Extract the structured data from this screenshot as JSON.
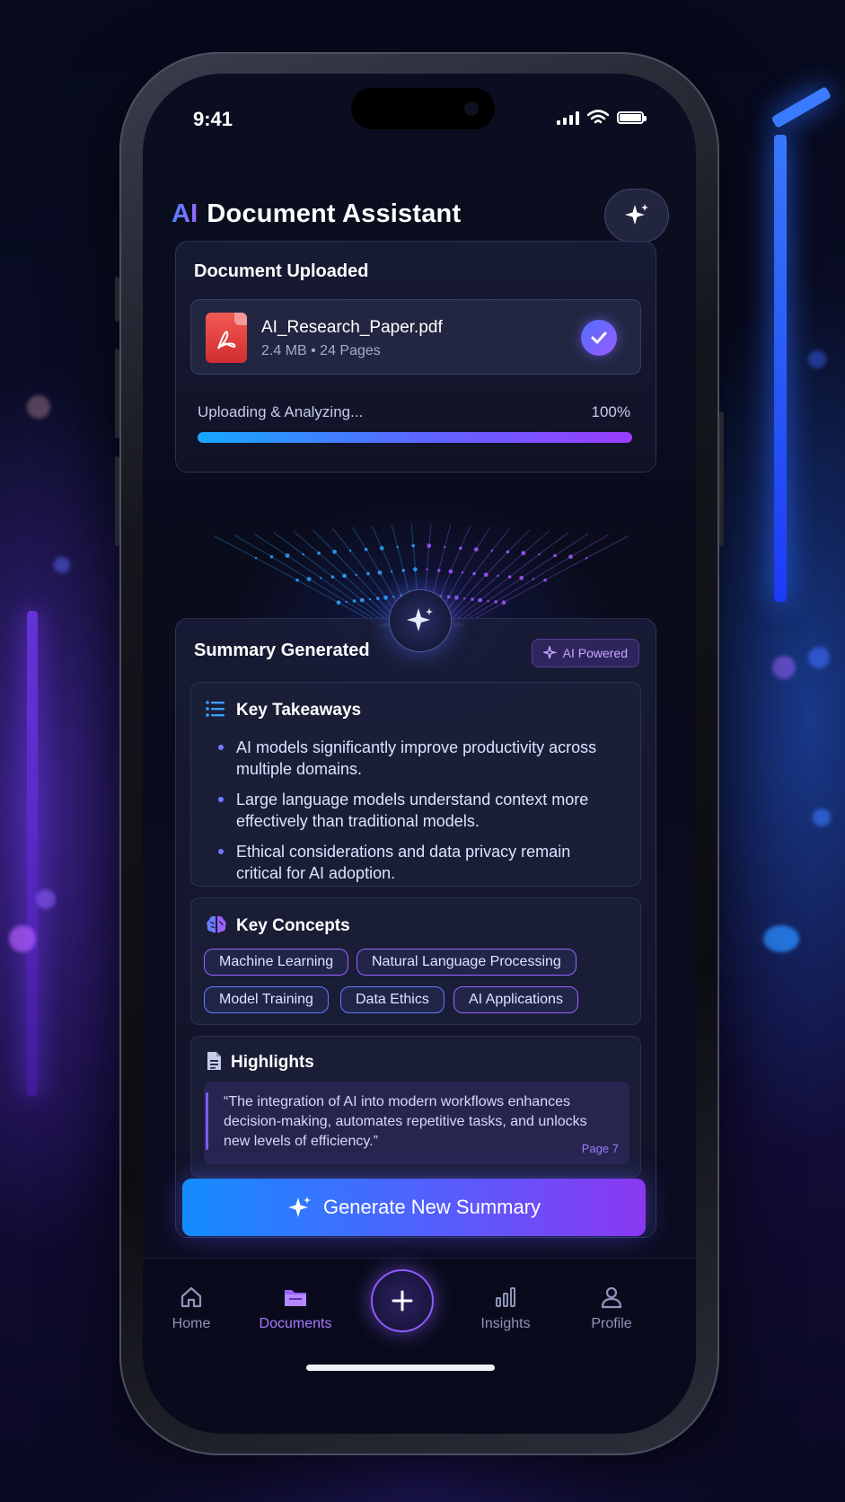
{
  "status": {
    "time": "9:41"
  },
  "header": {
    "ai_prefix": "AI",
    "title": "Document Assistant"
  },
  "upload_card": {
    "title": "Document Uploaded",
    "file_name": "AI_Research_Paper.pdf",
    "file_meta": "2.4 MB • 24 Pages",
    "progress_label": "Uploading & Analyzing...",
    "progress_text": "100%",
    "progress_value": 100
  },
  "summary_card": {
    "title": "Summary Generated",
    "badge": "AI Powered",
    "takeaways": {
      "title": "Key Takeaways",
      "items": [
        "AI models significantly improve productivity across multiple domains.",
        "Large language models understand context more effectively than traditional models.",
        "Ethical considerations and data privacy remain critical for AI adoption."
      ]
    },
    "concepts": {
      "title": "Key Concepts",
      "chips": [
        "Machine Learning",
        "Natural Language Processing",
        "Model Training",
        "Data Ethics",
        "AI Applications"
      ]
    },
    "highlights": {
      "title": "Highlights",
      "quote": "“The integration of AI into modern workflows enhances decision-making, automates repetitive tasks, and unlocks new levels of efficiency.”",
      "page": "Page 7"
    }
  },
  "cta": {
    "label": "Generate New Summary"
  },
  "tabbar": {
    "items": [
      {
        "label": "Home",
        "icon": "home-icon"
      },
      {
        "label": "Documents",
        "icon": "folder-icon"
      },
      {
        "label": "Insights",
        "icon": "bar-chart-icon"
      },
      {
        "label": "Profile",
        "icon": "person-icon"
      }
    ],
    "fab_icon": "plus-icon"
  },
  "colors": {
    "accent_blue": "#138dff",
    "accent_purple": "#8a38f0",
    "active_tab": "#a77bff"
  }
}
